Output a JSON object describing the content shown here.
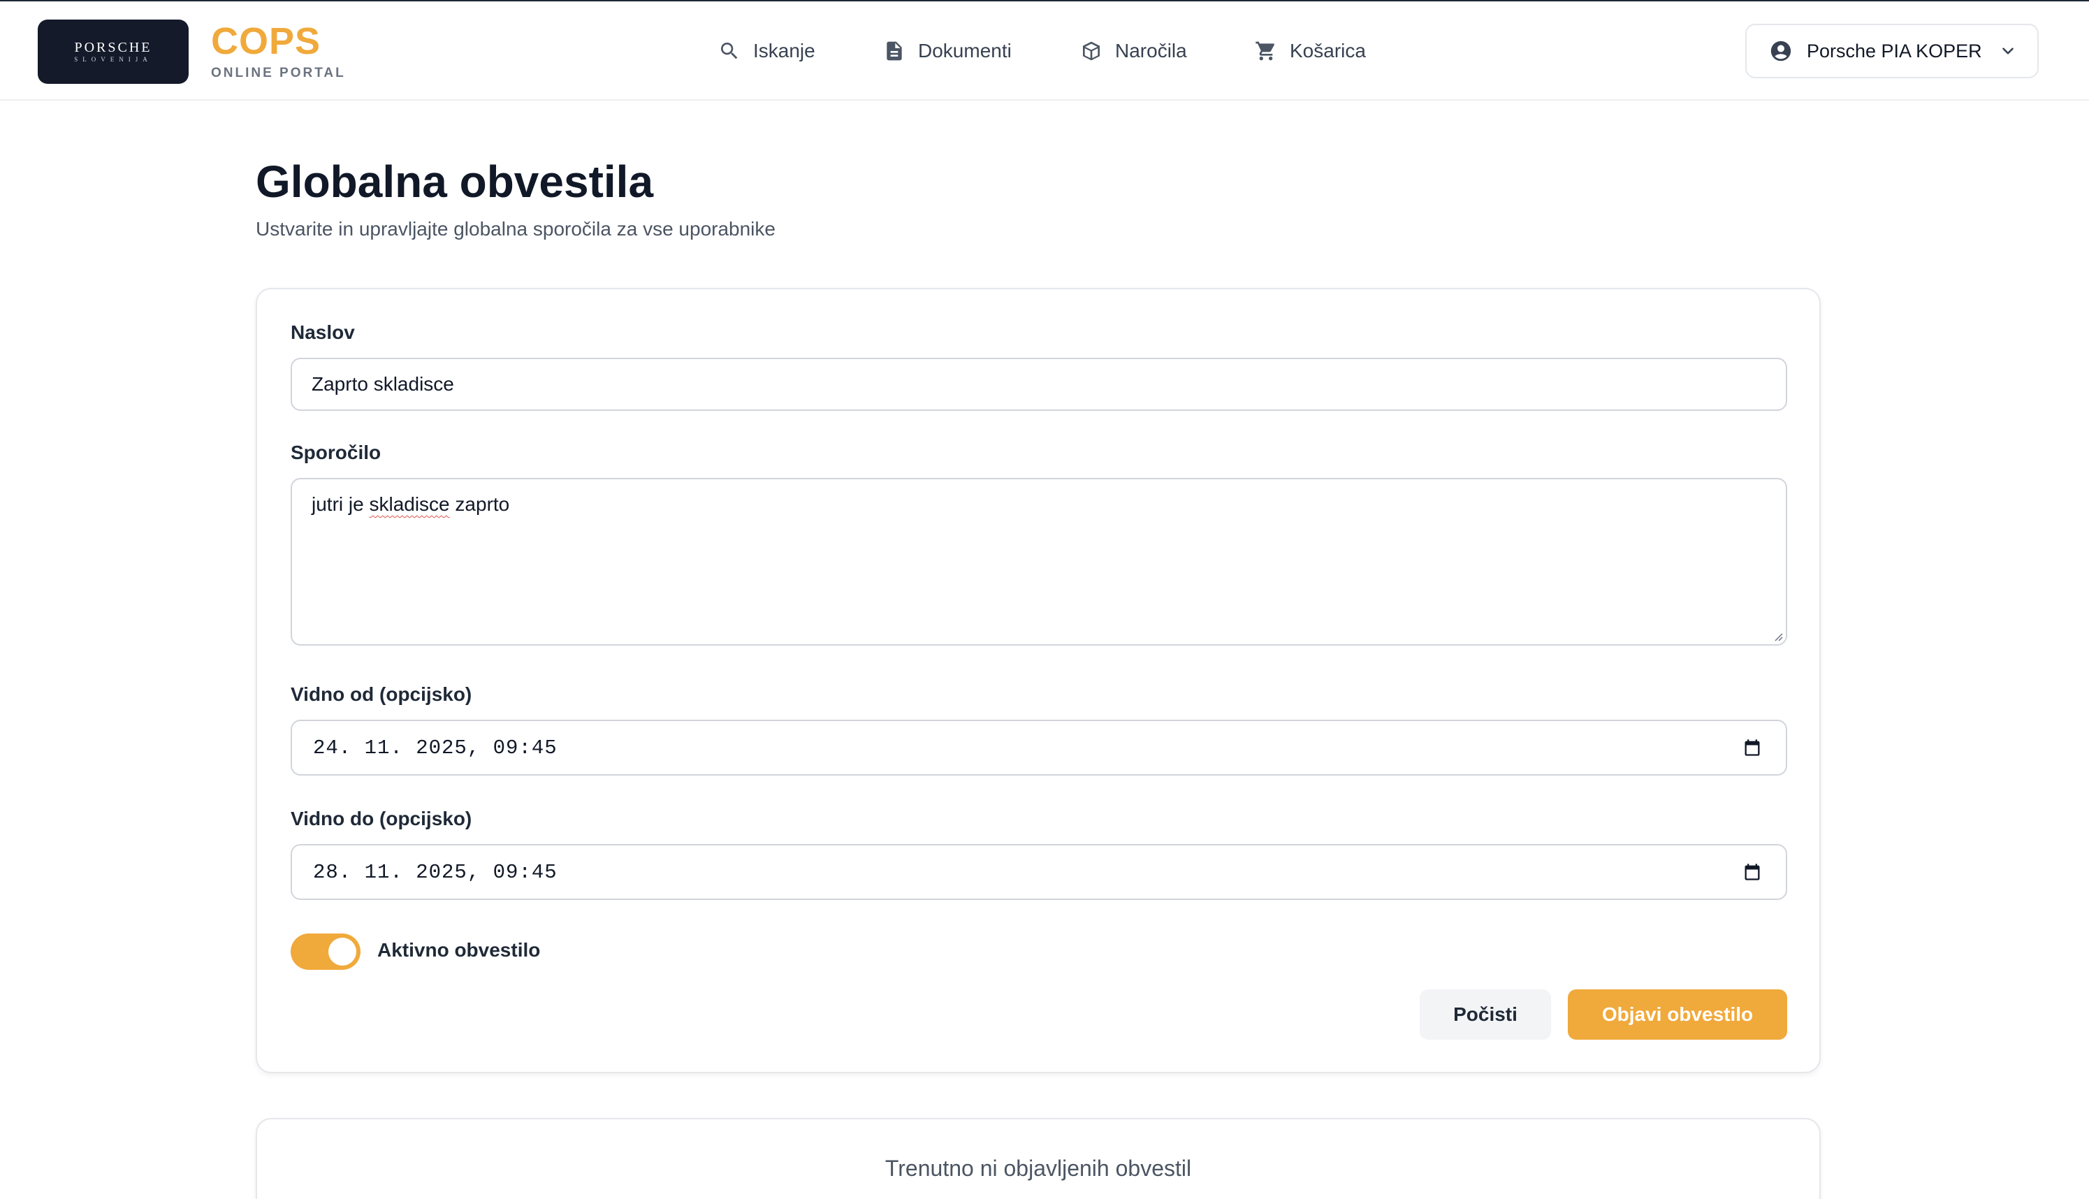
{
  "header": {
    "logo_main": "PORSCHE",
    "logo_sub": "SLOVENIJA",
    "brand_title": "COPS",
    "brand_subtitle": "ONLINE PORTAL",
    "nav": [
      {
        "label": "Iskanje",
        "icon": "search-icon"
      },
      {
        "label": "Dokumenti",
        "icon": "document-icon"
      },
      {
        "label": "Naročila",
        "icon": "package-icon"
      },
      {
        "label": "Košarica",
        "icon": "cart-icon"
      }
    ],
    "user": {
      "name": "Porsche PIA KOPER",
      "icon": "user-circle-icon"
    }
  },
  "page": {
    "title": "Globalna obvestila",
    "subtitle": "Ustvarite in upravljajte globalna sporočila za vse uporabnike"
  },
  "form": {
    "title_label": "Naslov",
    "title_value": "Zaprto skladisce",
    "message_label": "Sporočilo",
    "message_before": "jutri je ",
    "message_misspelled": "skladisce",
    "message_after": " zaprto",
    "visible_from_label": "Vidno od (opcijsko)",
    "visible_from_value": "24. 11. 2025, 09:45",
    "visible_to_label": "Vidno do (opcijsko)",
    "visible_to_value": "28. 11. 2025, 09:45",
    "active_label": "Aktivno obvestilo",
    "active": true,
    "clear_button": "Počisti",
    "publish_button": "Objavi obvestilo"
  },
  "notices": {
    "empty_text": "Trenutno ni objavljenih obvestil"
  },
  "colors": {
    "accent": "#f0a93b",
    "logo_bg": "#141a29",
    "text": "#111827",
    "muted": "#4b5563"
  }
}
